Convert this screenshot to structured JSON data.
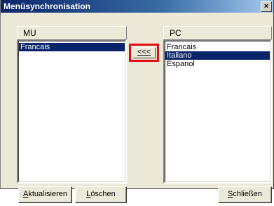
{
  "window": {
    "title": "Menüsynchronisation",
    "close_label": "×"
  },
  "left_panel": {
    "header": "MU",
    "items": [
      {
        "label": "Francais",
        "selected": true
      }
    ]
  },
  "right_panel": {
    "header": "PC",
    "items": [
      {
        "label": "Francais",
        "selected": false
      },
      {
        "label": "Italiano",
        "selected": true
      },
      {
        "label": "Espanol",
        "selected": false
      }
    ]
  },
  "transfer_button": {
    "label": "<<<"
  },
  "buttons": {
    "refresh": {
      "mnemonic": "A",
      "rest": "ktualisieren"
    },
    "delete": {
      "mnemonic": "L",
      "rest": "öschen"
    },
    "close": {
      "mnemonic": "S",
      "rest": "chließen"
    }
  },
  "colors": {
    "selection": "#0a246a",
    "highlight_frame": "#e01010",
    "face": "#ece9d8"
  }
}
